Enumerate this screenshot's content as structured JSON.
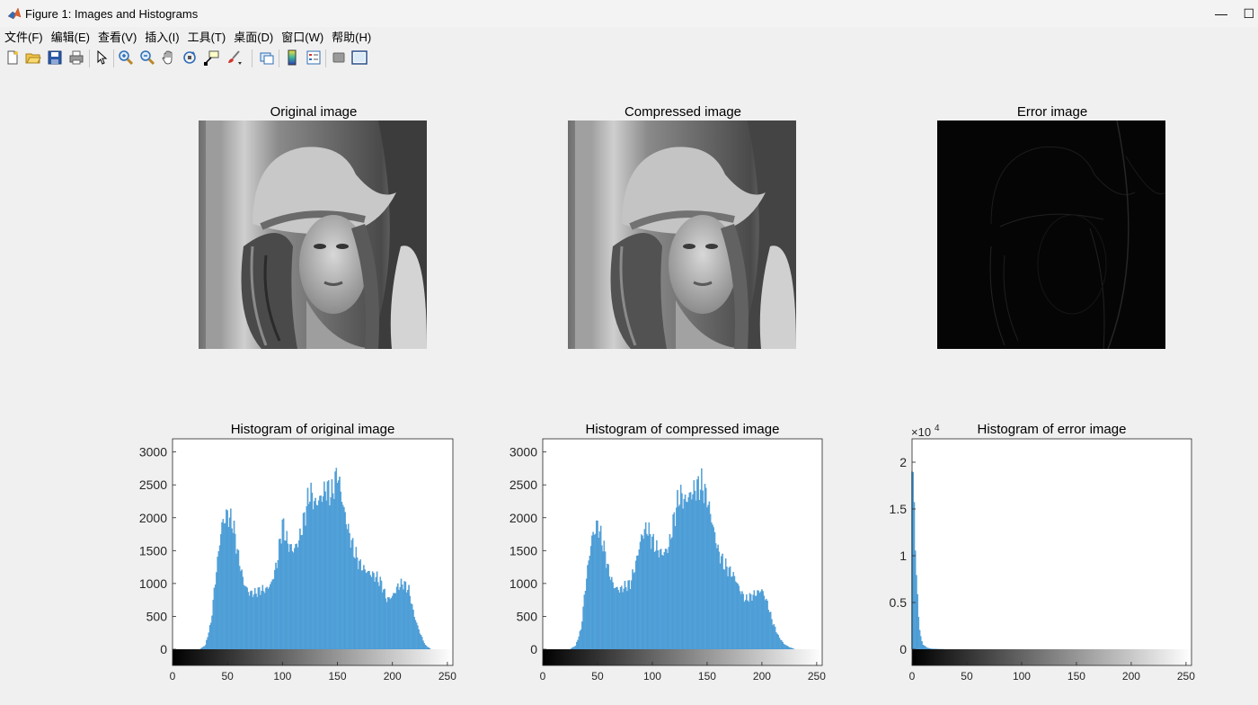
{
  "window": {
    "title": "Figure 1: Images and Histograms",
    "maximize_glyph": "☐",
    "minimize_glyph": "—"
  },
  "menu": [
    "文件(F)",
    "编辑(E)",
    "查看(V)",
    "插入(I)",
    "工具(T)",
    "桌面(D)",
    "窗口(W)",
    "帮助(H)"
  ],
  "toolbar": {
    "buttons": [
      "new-figure-icon",
      "open-file-icon",
      "save-icon",
      "print-icon",
      "edit-plot-arrow-icon",
      "zoom-in-icon",
      "zoom-out-icon",
      "pan-hand-icon",
      "rotate-3d-icon",
      "data-cursor-icon",
      "brush-icon",
      "link-plot-icon",
      "insert-colorbar-icon",
      "insert-legend-icon",
      "hide-plot-tools-icon",
      "show-plot-tools-icon"
    ]
  },
  "images": [
    {
      "title": "Original image"
    },
    {
      "title": "Compressed image"
    },
    {
      "title": "Error image"
    }
  ],
  "colors": {
    "bar": "#56a5dc",
    "bar_edge": "#3c8fcc",
    "axis": "#262626"
  },
  "chart_data": [
    {
      "type": "bar",
      "title": "Histogram of original image",
      "xlim": [
        0,
        255
      ],
      "ylim": [
        0,
        3200
      ],
      "yticks": [
        0,
        500,
        1000,
        1500,
        2000,
        2500,
        3000
      ],
      "xticks": [
        0,
        50,
        100,
        150,
        200,
        250
      ],
      "colorbar": "gray",
      "x": [
        25,
        30,
        35,
        40,
        45,
        50,
        55,
        60,
        65,
        70,
        75,
        80,
        85,
        90,
        95,
        100,
        105,
        110,
        115,
        120,
        125,
        130,
        135,
        140,
        145,
        150,
        155,
        160,
        165,
        170,
        175,
        180,
        185,
        190,
        195,
        200,
        205,
        210,
        215,
        220,
        225,
        230,
        235
      ],
      "values": [
        0,
        60,
        400,
        1200,
        1900,
        2050,
        1900,
        1400,
        1000,
        850,
        850,
        900,
        900,
        1000,
        1300,
        1900,
        1600,
        1500,
        1650,
        2000,
        2400,
        2200,
        2300,
        2450,
        2350,
        2700,
        2200,
        1800,
        1500,
        1300,
        1200,
        1150,
        1100,
        1000,
        750,
        800,
        950,
        1000,
        900,
        500,
        250,
        60,
        0
      ]
    },
    {
      "type": "bar",
      "title": "Histogram of compressed image",
      "xlim": [
        0,
        255
      ],
      "ylim": [
        0,
        3200
      ],
      "yticks": [
        0,
        500,
        1000,
        1500,
        2000,
        2500,
        3000
      ],
      "xticks": [
        0,
        50,
        100,
        150,
        200,
        250
      ],
      "colorbar": "gray",
      "x": [
        25,
        30,
        35,
        40,
        45,
        50,
        55,
        60,
        65,
        70,
        75,
        80,
        85,
        90,
        95,
        100,
        105,
        110,
        115,
        120,
        125,
        130,
        135,
        140,
        145,
        150,
        155,
        160,
        165,
        170,
        175,
        180,
        185,
        190,
        195,
        200,
        205,
        210,
        215,
        220,
        225,
        230,
        235,
        240
      ],
      "values": [
        0,
        50,
        300,
        1100,
        1700,
        1900,
        1600,
        1200,
        950,
        900,
        950,
        1000,
        1300,
        1700,
        1850,
        1650,
        1500,
        1450,
        1550,
        2000,
        2350,
        2250,
        2350,
        2450,
        2500,
        2300,
        1900,
        1500,
        1300,
        1200,
        1100,
        900,
        750,
        800,
        850,
        900,
        700,
        400,
        200,
        80,
        30,
        0,
        0,
        0
      ]
    },
    {
      "type": "bar",
      "title": "Histogram of error image",
      "xlim": [
        0,
        255
      ],
      "ylim": [
        0,
        22500
      ],
      "yticks": [
        0,
        5000,
        10000,
        15000,
        20000
      ],
      "ytick_labels": [
        "0",
        "0.5",
        "1",
        "1.5",
        "2"
      ],
      "exponent_label": "×10",
      "exponent_power": "4",
      "xticks": [
        0,
        50,
        100,
        150,
        200,
        250
      ],
      "colorbar": "gray",
      "x": [
        0,
        1,
        2,
        3,
        4,
        5,
        6,
        7,
        8,
        9,
        10,
        12,
        14,
        16,
        18,
        20,
        25,
        30
      ],
      "values": [
        19000,
        18500,
        15500,
        11000,
        8000,
        5500,
        3500,
        2200,
        1300,
        800,
        500,
        300,
        150,
        80,
        40,
        20,
        5,
        0
      ]
    }
  ]
}
